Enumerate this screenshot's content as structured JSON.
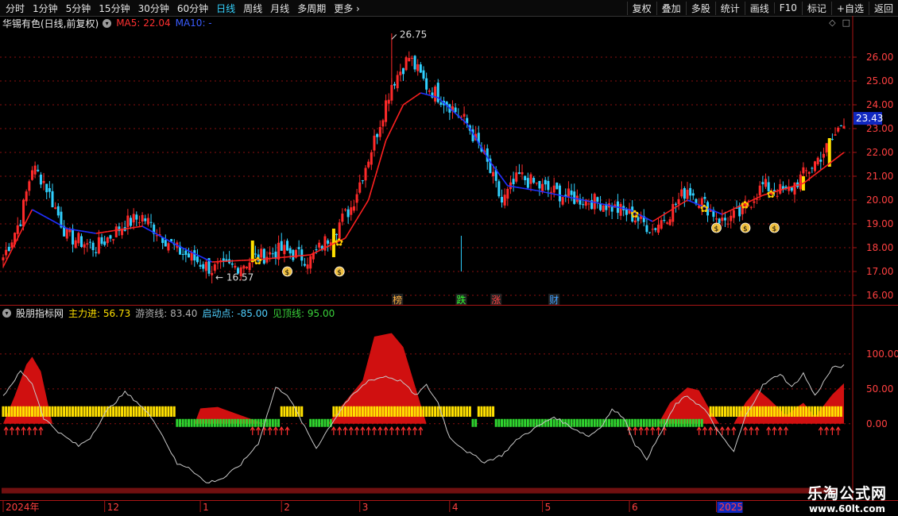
{
  "toolbar": {
    "left": [
      "分时",
      "1分钟",
      "5分钟",
      "15分钟",
      "30分钟",
      "60分钟",
      "日线",
      "周线",
      "月线",
      "多周期",
      "更多"
    ],
    "active_index": 6,
    "right": [
      "复权",
      "叠加",
      "多股",
      "统计",
      "画线",
      "F10",
      "标记",
      "+自选",
      "返回"
    ]
  },
  "header": {
    "title": "华锡有色(日线,前复权)",
    "ma5_label": "MA5: 22.04",
    "ma10_label": "MA10: -"
  },
  "sub_header": {
    "name": "股朋指标网",
    "main_force": "主力进: 56.73",
    "swim_line": "游资线: 83.40",
    "start_point": "启动点: -85.00",
    "top_line": "见顶线: 95.00"
  },
  "colors": {
    "background": "#000000",
    "up": "#ff2a2a",
    "down": "#30d0ff",
    "ma_up": "#ff2020",
    "ma_down": "#2030ff",
    "grid": "#8a1010",
    "yellow_bar": "#ffe000",
    "green_bar": "#2fd32f",
    "area_fill": "#d01010"
  },
  "chart_data": [
    {
      "type": "candlestick",
      "ylim": [
        15.6,
        27.2
      ],
      "y_ticks": [
        "26.00",
        "25.00",
        "24.00",
        "23.00",
        "22.00",
        "21.00",
        "20.00",
        "19.00",
        "18.00",
        "17.00",
        "16.00"
      ],
      "current_price": "23.43",
      "high_label": "26.75",
      "low_label": "16.57",
      "events": [
        "榜",
        "跌",
        "涨",
        "财"
      ],
      "close_keypoints": [
        [
          0,
          17.6
        ],
        [
          6,
          19.2
        ],
        [
          10,
          21.4
        ],
        [
          14,
          20.8
        ],
        [
          22,
          18.5
        ],
        [
          32,
          18.0
        ],
        [
          42,
          19.0
        ],
        [
          48,
          19.3
        ],
        [
          60,
          17.9
        ],
        [
          72,
          17.1
        ],
        [
          80,
          17.2
        ],
        [
          88,
          17.6
        ],
        [
          96,
          17.9
        ],
        [
          106,
          17.5
        ],
        [
          114,
          18.7
        ],
        [
          120,
          19.7
        ],
        [
          128,
          22.5
        ],
        [
          134,
          24.9
        ],
        [
          140,
          26.0
        ],
        [
          146,
          24.8
        ],
        [
          154,
          24.0
        ],
        [
          160,
          23.2
        ],
        [
          166,
          21.8
        ],
        [
          172,
          19.9
        ],
        [
          178,
          21.0
        ],
        [
          186,
          20.5
        ],
        [
          196,
          20.1
        ],
        [
          206,
          19.9
        ],
        [
          216,
          19.4
        ],
        [
          224,
          18.8
        ],
        [
          230,
          19.5
        ],
        [
          236,
          20.5
        ],
        [
          242,
          19.8
        ],
        [
          248,
          19.1
        ],
        [
          254,
          19.4
        ],
        [
          262,
          20.6
        ],
        [
          270,
          20.3
        ],
        [
          278,
          21.3
        ],
        [
          285,
          22.3
        ],
        [
          290,
          23.4
        ]
      ],
      "ma_keypoints": [
        [
          0,
          17.2
        ],
        [
          10,
          19.6
        ],
        [
          22,
          18.8
        ],
        [
          32,
          18.6
        ],
        [
          48,
          18.9
        ],
        [
          60,
          18.1
        ],
        [
          72,
          17.4
        ],
        [
          88,
          17.5
        ],
        [
          106,
          17.7
        ],
        [
          118,
          18.4
        ],
        [
          126,
          20.0
        ],
        [
          132,
          22.5
        ],
        [
          138,
          24.0
        ],
        [
          144,
          24.5
        ],
        [
          150,
          24.3
        ],
        [
          160,
          23.2
        ],
        [
          168,
          21.6
        ],
        [
          174,
          20.6
        ],
        [
          184,
          20.4
        ],
        [
          200,
          20.0
        ],
        [
          216,
          19.6
        ],
        [
          224,
          19.1
        ],
        [
          236,
          20.0
        ],
        [
          248,
          19.4
        ],
        [
          262,
          20.2
        ],
        [
          276,
          20.7
        ],
        [
          290,
          22.0
        ]
      ]
    },
    {
      "type": "area",
      "ylim": [
        -105,
        150
      ],
      "y_ticks": [
        "100.00",
        "50.00",
        "0.00"
      ],
      "main_force_keypoints": [
        [
          0,
          0
        ],
        [
          4,
          40
        ],
        [
          8,
          85
        ],
        [
          10,
          96
        ],
        [
          13,
          75
        ],
        [
          16,
          18
        ],
        [
          17,
          0
        ],
        [
          66,
          0
        ],
        [
          68,
          22
        ],
        [
          74,
          24
        ],
        [
          82,
          12
        ],
        [
          90,
          0
        ],
        [
          112,
          0
        ],
        [
          116,
          22
        ],
        [
          124,
          62
        ],
        [
          128,
          125
        ],
        [
          134,
          130
        ],
        [
          138,
          110
        ],
        [
          142,
          55
        ],
        [
          146,
          0
        ],
        [
          226,
          0
        ],
        [
          230,
          30
        ],
        [
          236,
          52
        ],
        [
          240,
          48
        ],
        [
          244,
          18
        ],
        [
          247,
          0
        ],
        [
          252,
          0
        ],
        [
          256,
          30
        ],
        [
          260,
          50
        ],
        [
          264,
          36
        ],
        [
          270,
          12
        ],
        [
          276,
          30
        ],
        [
          280,
          10
        ],
        [
          286,
          42
        ],
        [
          290,
          58
        ]
      ],
      "swim_line_keypoints": [
        [
          0,
          40
        ],
        [
          6,
          75
        ],
        [
          10,
          58
        ],
        [
          14,
          8
        ],
        [
          20,
          -15
        ],
        [
          26,
          -32
        ],
        [
          30,
          -20
        ],
        [
          36,
          20
        ],
        [
          42,
          45
        ],
        [
          46,
          32
        ],
        [
          52,
          5
        ],
        [
          56,
          -25
        ],
        [
          60,
          -58
        ],
        [
          64,
          -62
        ],
        [
          70,
          -85
        ],
        [
          76,
          -78
        ],
        [
          82,
          -58
        ],
        [
          88,
          -28
        ],
        [
          94,
          52
        ],
        [
          98,
          42
        ],
        [
          104,
          -5
        ],
        [
          108,
          -35
        ],
        [
          112,
          -8
        ],
        [
          118,
          30
        ],
        [
          126,
          62
        ],
        [
          132,
          68
        ],
        [
          138,
          60
        ],
        [
          142,
          40
        ],
        [
          146,
          55
        ],
        [
          150,
          30
        ],
        [
          154,
          -20
        ],
        [
          160,
          -40
        ],
        [
          166,
          -55
        ],
        [
          172,
          -45
        ],
        [
          178,
          -20
        ],
        [
          184,
          -5
        ],
        [
          190,
          10
        ],
        [
          196,
          -5
        ],
        [
          202,
          -18
        ],
        [
          206,
          -5
        ],
        [
          210,
          20
        ],
        [
          214,
          10
        ],
        [
          218,
          -30
        ],
        [
          222,
          -50
        ],
        [
          226,
          -20
        ],
        [
          232,
          28
        ],
        [
          236,
          40
        ],
        [
          242,
          20
        ],
        [
          248,
          -20
        ],
        [
          252,
          -40
        ],
        [
          256,
          10
        ],
        [
          262,
          55
        ],
        [
          268,
          72
        ],
        [
          272,
          52
        ],
        [
          276,
          72
        ],
        [
          280,
          40
        ],
        [
          286,
          80
        ],
        [
          290,
          83
        ]
      ]
    }
  ],
  "x_axis": {
    "labels": [
      "2024年",
      "12",
      "1",
      "2",
      "3",
      "4",
      "5",
      "6",
      "2025"
    ]
  },
  "watermark": {
    "title": "乐淘公式网",
    "url": "www.60lt.com"
  }
}
